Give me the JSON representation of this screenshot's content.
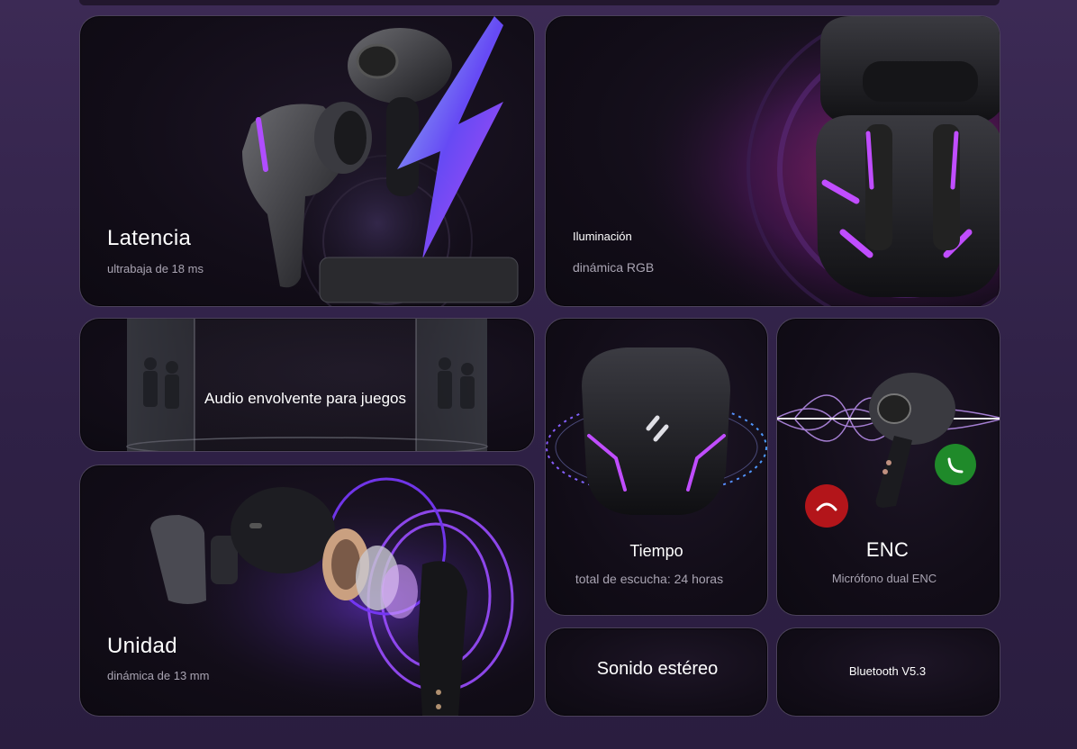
{
  "cards": {
    "latency": {
      "title": "Latencia",
      "subtitle": "ultrabaja de 18 ms"
    },
    "rgb": {
      "title": "Iluminación",
      "subtitle": "dinámica RGB"
    },
    "gaming": {
      "title": "Audio envolvente para juegos"
    },
    "driver": {
      "title": "Unidad",
      "subtitle": "dinámica de 13 mm"
    },
    "playtime": {
      "title": "Tiempo",
      "subtitle": "total de escucha: 24 horas"
    },
    "enc": {
      "title": "ENC",
      "subtitle": "Micrófono dual ENC"
    },
    "stereo": {
      "title": "Sonido estéreo"
    },
    "bluetooth": {
      "title": "Bluetooth V5.3"
    }
  },
  "colors": {
    "accent_purple": "#b04dff",
    "accent_blue": "#4b6bff",
    "answer_green": "#1f8a2a",
    "decline_red": "#b3151a"
  }
}
